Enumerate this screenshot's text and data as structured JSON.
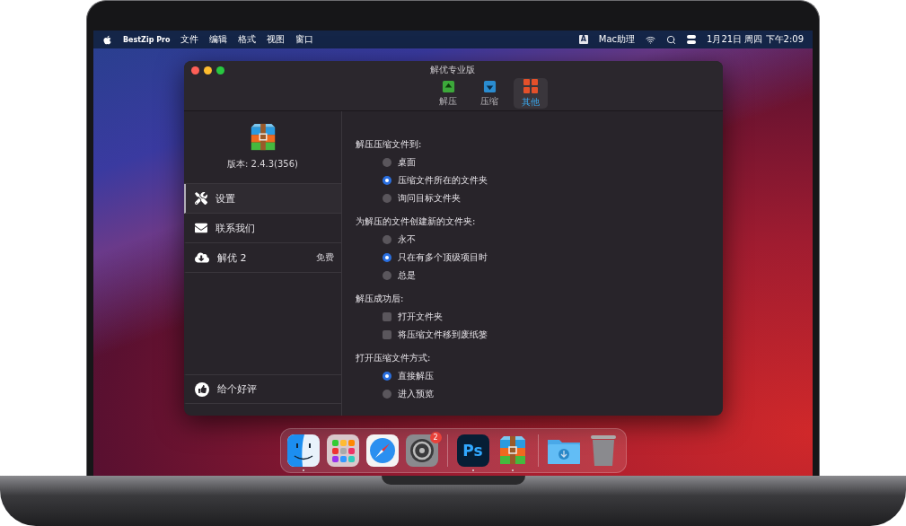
{
  "menu_bar": {
    "app_name": "BestZip Pro",
    "menus": [
      "文件",
      "编辑",
      "格式",
      "视图",
      "窗口"
    ],
    "input_source": "A",
    "assistant": "Mac助理",
    "clock": "1月21日 周四 下午2:09"
  },
  "window": {
    "title": "解优专业版",
    "tabs": [
      {
        "label": "解压",
        "kind": "extract",
        "selected": false
      },
      {
        "label": "压缩",
        "kind": "compress",
        "selected": false
      },
      {
        "label": "其他",
        "kind": "other",
        "selected": true
      }
    ],
    "sidebar": {
      "version": "版本: 2.4.3(356)",
      "items": [
        {
          "label": "设置",
          "kind": "settings",
          "selected": true
        },
        {
          "label": "联系我们",
          "kind": "mail",
          "selected": false
        },
        {
          "label": "解优 2",
          "kind": "download",
          "selected": false,
          "badge": "免费"
        }
      ],
      "footer_item": {
        "label": "给个好评",
        "kind": "like"
      }
    },
    "settings": [
      {
        "title": "解压压缩文件到:",
        "options": [
          {
            "kind": "radio",
            "label": "桌面",
            "selected": false
          },
          {
            "kind": "radio",
            "label": "压缩文件所在的文件夹",
            "selected": true
          },
          {
            "kind": "radio",
            "label": "询问目标文件夹",
            "selected": false
          }
        ]
      },
      {
        "title": "为解压的文件创建新的文件夹:",
        "options": [
          {
            "kind": "radio",
            "label": "永不",
            "selected": false
          },
          {
            "kind": "radio",
            "label": "只在有多个顶级项目时",
            "selected": true
          },
          {
            "kind": "radio",
            "label": "总是",
            "selected": false
          }
        ]
      },
      {
        "title": "解压成功后:",
        "options": [
          {
            "kind": "checkbox",
            "label": "打开文件夹",
            "checked": false
          },
          {
            "kind": "checkbox",
            "label": "将压缩文件移到废纸篓",
            "checked": false
          }
        ]
      },
      {
        "title": "打开压缩文件方式:",
        "options": [
          {
            "kind": "radio",
            "label": "直接解压",
            "selected": true
          },
          {
            "kind": "radio",
            "label": "进入预览",
            "selected": false
          }
        ]
      }
    ]
  },
  "dock": {
    "groups": [
      [
        {
          "kind": "finder",
          "running": true
        },
        {
          "kind": "launchpad",
          "running": false
        },
        {
          "kind": "safari",
          "running": false
        },
        {
          "kind": "settings",
          "running": false,
          "badge": "2"
        }
      ],
      [
        {
          "kind": "photoshop",
          "label": "Ps",
          "running": true
        },
        {
          "kind": "archive",
          "running": true
        }
      ],
      [
        {
          "kind": "downloads",
          "running": false
        },
        {
          "kind": "trash",
          "running": false
        }
      ]
    ]
  }
}
